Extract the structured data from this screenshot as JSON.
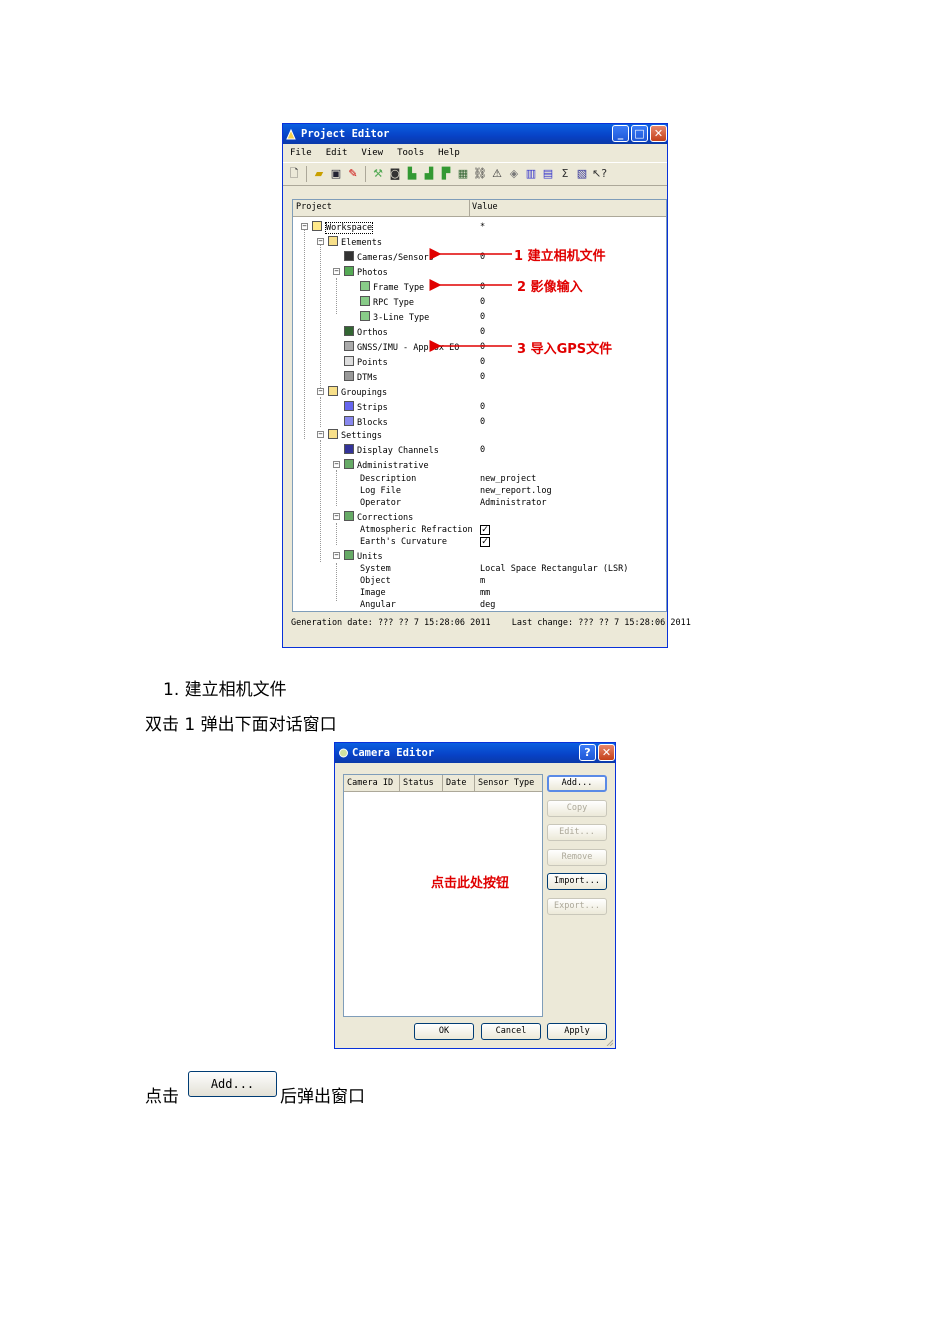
{
  "project_editor": {
    "title": "Project Editor",
    "menu": [
      "File",
      "Edit",
      "View",
      "Tools",
      "Help"
    ],
    "columns": {
      "project": "Project",
      "value": "Value"
    },
    "tree": [
      {
        "label": "Workspace",
        "value": "*"
      },
      {
        "label": "Elements",
        "value": ""
      },
      {
        "label": "Cameras/Sensors",
        "value": "0"
      },
      {
        "label": "Photos",
        "value": ""
      },
      {
        "label": "Frame Type",
        "value": "0"
      },
      {
        "label": "RPC Type",
        "value": "0"
      },
      {
        "label": "3-Line Type",
        "value": "0"
      },
      {
        "label": "Orthos",
        "value": "0"
      },
      {
        "label": "GNSS/IMU - Approx EO",
        "value": "0"
      },
      {
        "label": "Points",
        "value": "0"
      },
      {
        "label": "DTMs",
        "value": "0"
      },
      {
        "label": "Groupings",
        "value": ""
      },
      {
        "label": "Strips",
        "value": "0"
      },
      {
        "label": "Blocks",
        "value": "0"
      },
      {
        "label": "Settings",
        "value": ""
      },
      {
        "label": "Display Channels",
        "value": "0"
      },
      {
        "label": "Administrative",
        "value": ""
      },
      {
        "label": "Description",
        "value": "new_project"
      },
      {
        "label": "Log File",
        "value": "new_report.log"
      },
      {
        "label": "Operator",
        "value": "Administrator"
      },
      {
        "label": "Corrections",
        "value": ""
      },
      {
        "label": "Atmospheric Refraction",
        "value": "checked"
      },
      {
        "label": "Earth's Curvature",
        "value": "checked"
      },
      {
        "label": "Units",
        "value": ""
      },
      {
        "label": "System",
        "value": "Local Space Rectangular (LSR)"
      },
      {
        "label": "Object",
        "value": "m"
      },
      {
        "label": "Image",
        "value": "mm"
      },
      {
        "label": "Angular",
        "value": "deg"
      }
    ],
    "annotations": [
      "1 建立相机文件",
      "2  影像输入",
      "3 导入GPS文件"
    ],
    "status": {
      "generation": "Generation date: ??? ?? 7 15:28:06 2011",
      "last_change": "Last change: ??? ?? 7 15:28:06 2011"
    }
  },
  "text": {
    "step1": "1. 建立相机文件",
    "instruction": "双击 1 弹出下面对话窗口",
    "click_prefix": "点击",
    "click_suffix": "后弹出窗口"
  },
  "camera_editor": {
    "title": "Camera Editor",
    "columns": [
      "Camera ID",
      "Status",
      "Date",
      "Sensor Type"
    ],
    "side_buttons": [
      {
        "label": "Add...",
        "enabled": true
      },
      {
        "label": "Copy",
        "enabled": false
      },
      {
        "label": "Edit...",
        "enabled": false
      },
      {
        "label": "Remove",
        "enabled": false
      },
      {
        "label": "Import...",
        "enabled": true
      },
      {
        "label": "Export...",
        "enabled": false
      }
    ],
    "bottom_buttons": [
      "OK",
      "Cancel",
      "Apply"
    ],
    "annotation": "点击此处按钮"
  },
  "inline_button": "Add...",
  "colors": {
    "annotation": "#e00000",
    "title_bar": "#0842c6"
  }
}
